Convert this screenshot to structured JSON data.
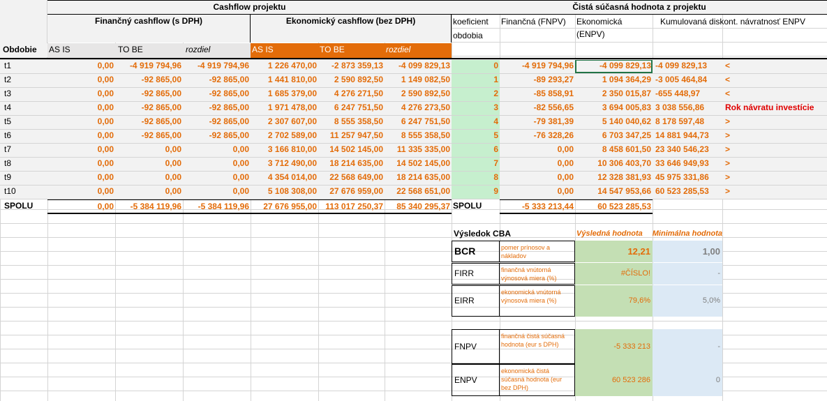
{
  "header": {
    "cashflow_title": "Cashflow projektu",
    "npv_title": "Čistá súčasná hodnota z projektu",
    "financial_cf": "Finančný cashflow (s DPH)",
    "economic_cf": "Ekonomický cashflow (bez DPH)",
    "period": "Obdobie",
    "as_is": "AS IS",
    "to_be": "TO BE",
    "diff": "rozdiel",
    "coef1": "koeficient",
    "coef2": "obdobia",
    "fnpv": "Finančná (FNPV)",
    "enpv1": "Ekonomická",
    "enpv2": "(ENPV)",
    "cumulative": "Kumulovaná diskont. návratnosť ENPV"
  },
  "rows": [
    {
      "period": "t1",
      "f_asis": "0,00",
      "f_tobe": "-4 919 794,96",
      "f_diff": "-4 919 794,96",
      "e_asis": "1 226 470,00",
      "e_tobe": "-2 873 359,13",
      "e_diff": "-4 099 829,13",
      "coef": "0",
      "fnpv": "-4 919 794,96",
      "enpv": "-4 099 829,13",
      "cum": "-4 099 829,13",
      "flag": "<"
    },
    {
      "period": "t2",
      "f_asis": "0,00",
      "f_tobe": "-92 865,00",
      "f_diff": "-92 865,00",
      "e_asis": "1 441 810,00",
      "e_tobe": "2 590 892,50",
      "e_diff": "1 149 082,50",
      "coef": "1",
      "fnpv": "-89 293,27",
      "enpv": "1 094 364,29",
      "cum": "-3 005 464,84",
      "flag": "<"
    },
    {
      "period": "t3",
      "f_asis": "0,00",
      "f_tobe": "-92 865,00",
      "f_diff": "-92 865,00",
      "e_asis": "1 685 379,00",
      "e_tobe": "4 276 271,50",
      "e_diff": "2 590 892,50",
      "coef": "2",
      "fnpv": "-85 858,91",
      "enpv": "2 350 015,87",
      "cum": "-655 448,97",
      "flag": "<"
    },
    {
      "period": "t4",
      "f_asis": "0,00",
      "f_tobe": "-92 865,00",
      "f_diff": "-92 865,00",
      "e_asis": "1 971 478,00",
      "e_tobe": "6 247 751,50",
      "e_diff": "4 276 273,50",
      "coef": "3",
      "fnpv": "-82 556,65",
      "enpv": "3 694 005,83",
      "cum": "3 038 556,86",
      "flag": "Rok návratu investície"
    },
    {
      "period": "t5",
      "f_asis": "0,00",
      "f_tobe": "-92 865,00",
      "f_diff": "-92 865,00",
      "e_asis": "2 307 607,00",
      "e_tobe": "8 555 358,50",
      "e_diff": "6 247 751,50",
      "coef": "4",
      "fnpv": "-79 381,39",
      "enpv": "5 140 040,62",
      "cum": "8 178 597,48",
      "flag": ">"
    },
    {
      "period": "t6",
      "f_asis": "0,00",
      "f_tobe": "-92 865,00",
      "f_diff": "-92 865,00",
      "e_asis": "2 702 589,00",
      "e_tobe": "11 257 947,50",
      "e_diff": "8 555 358,50",
      "coef": "5",
      "fnpv": "-76 328,26",
      "enpv": "6 703 347,25",
      "cum": "14 881 944,73",
      "flag": ">"
    },
    {
      "period": "t7",
      "f_asis": "0,00",
      "f_tobe": "0,00",
      "f_diff": "0,00",
      "e_asis": "3 166 810,00",
      "e_tobe": "14 502 145,00",
      "e_diff": "11 335 335,00",
      "coef": "6",
      "fnpv": "0,00",
      "enpv": "8 458 601,50",
      "cum": "23 340 546,23",
      "flag": ">"
    },
    {
      "period": "t8",
      "f_asis": "0,00",
      "f_tobe": "0,00",
      "f_diff": "0,00",
      "e_asis": "3 712 490,00",
      "e_tobe": "18 214 635,00",
      "e_diff": "14 502 145,00",
      "coef": "7",
      "fnpv": "0,00",
      "enpv": "10 306 403,70",
      "cum": "33 646 949,93",
      "flag": ">"
    },
    {
      "period": "t9",
      "f_asis": "0,00",
      "f_tobe": "0,00",
      "f_diff": "0,00",
      "e_asis": "4 354 014,00",
      "e_tobe": "22 568 649,00",
      "e_diff": "18 214 635,00",
      "coef": "8",
      "fnpv": "0,00",
      "enpv": "12 328 381,93",
      "cum": "45 975 331,86",
      "flag": ">"
    },
    {
      "period": "t10",
      "f_asis": "0,00",
      "f_tobe": "0,00",
      "f_diff": "0,00",
      "e_asis": "5 108 308,00",
      "e_tobe": "27 676 959,00",
      "e_diff": "22 568 651,00",
      "coef": "9",
      "fnpv": "0,00",
      "enpv": "14 547 953,66",
      "cum": "60 523 285,53",
      "flag": ">"
    }
  ],
  "totals": {
    "label": "SPOLU",
    "f_asis": "0,00",
    "f_tobe": "-5 384 119,96",
    "f_diff": "-5 384 119,96",
    "e_asis": "27 676 955,00",
    "e_tobe": "113 017 250,37",
    "e_diff": "85 340 295,37",
    "label2": "SPOLU",
    "fnpv": "-5 333 213,44",
    "enpv": "60 523 285,53"
  },
  "cba": {
    "title": "Výsledok CBA",
    "col_result": "Výsledná hodnota",
    "col_min": "Minimálna hodnota",
    "rows": [
      {
        "code": "BCR",
        "desc": "pomer prínosov a nákladov",
        "result": "12,21",
        "min": "1,00"
      },
      {
        "code": "FIRR",
        "desc": "finančná vnútorná výnosová miera (%)",
        "result": "#ČÍSLO!",
        "min": "-"
      },
      {
        "code": "EIRR",
        "desc": "ekonomická vnútorná výnosová miera (%)",
        "result": "79,6%",
        "min": "5,0%"
      },
      {
        "code": "FNPV",
        "desc": "finančná čistá súčasná hodnota (eur s DPH)",
        "result": "-5 333 213",
        "min": "-"
      },
      {
        "code": "ENPV",
        "desc": "ekonomická čistá súčasná hodnota (eur bez DPH)",
        "result": "60 523 286",
        "min": "0"
      }
    ]
  }
}
